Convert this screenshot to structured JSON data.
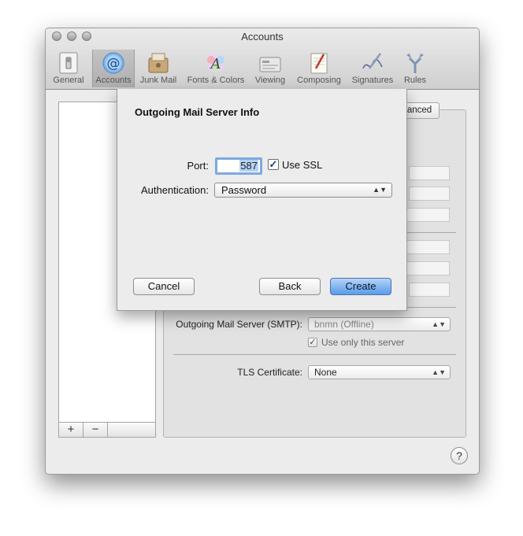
{
  "window": {
    "title": "Accounts"
  },
  "toolbar": {
    "items": [
      {
        "label": "General",
        "icon": "general-switch-icon"
      },
      {
        "label": "Accounts",
        "icon": "at-sign-icon"
      },
      {
        "label": "Junk Mail",
        "icon": "junk-mail-icon"
      },
      {
        "label": "Fonts & Colors",
        "icon": "fonts-colors-icon"
      },
      {
        "label": "Viewing",
        "icon": "viewing-icon"
      },
      {
        "label": "Composing",
        "icon": "composing-icon"
      },
      {
        "label": "Signatures",
        "icon": "signatures-icon"
      },
      {
        "label": "Rules",
        "icon": "rules-icon"
      }
    ],
    "selected": "Accounts"
  },
  "account_list": {
    "add_label": "+",
    "remove_label": "−"
  },
  "tabs": {
    "advanced_label": "Advanced"
  },
  "detail": {
    "outgoing_label": "Outgoing Mail Server (SMTP):",
    "outgoing_value": "bnmn (Offline)",
    "use_only_label": "Use only this server",
    "tls_label": "TLS Certificate:",
    "tls_value": "None"
  },
  "sheet": {
    "title": "Outgoing Mail Server Info",
    "port_label": "Port:",
    "port_value": "587",
    "ssl_label": "Use SSL",
    "auth_label": "Authentication:",
    "auth_value": "Password",
    "cancel_label": "Cancel",
    "back_label": "Back",
    "create_label": "Create"
  },
  "help": {
    "label": "?"
  },
  "colors": {
    "accent": "#5a9be8",
    "focus_ring": "#7fa8de",
    "selection": "#b5d2f5"
  }
}
